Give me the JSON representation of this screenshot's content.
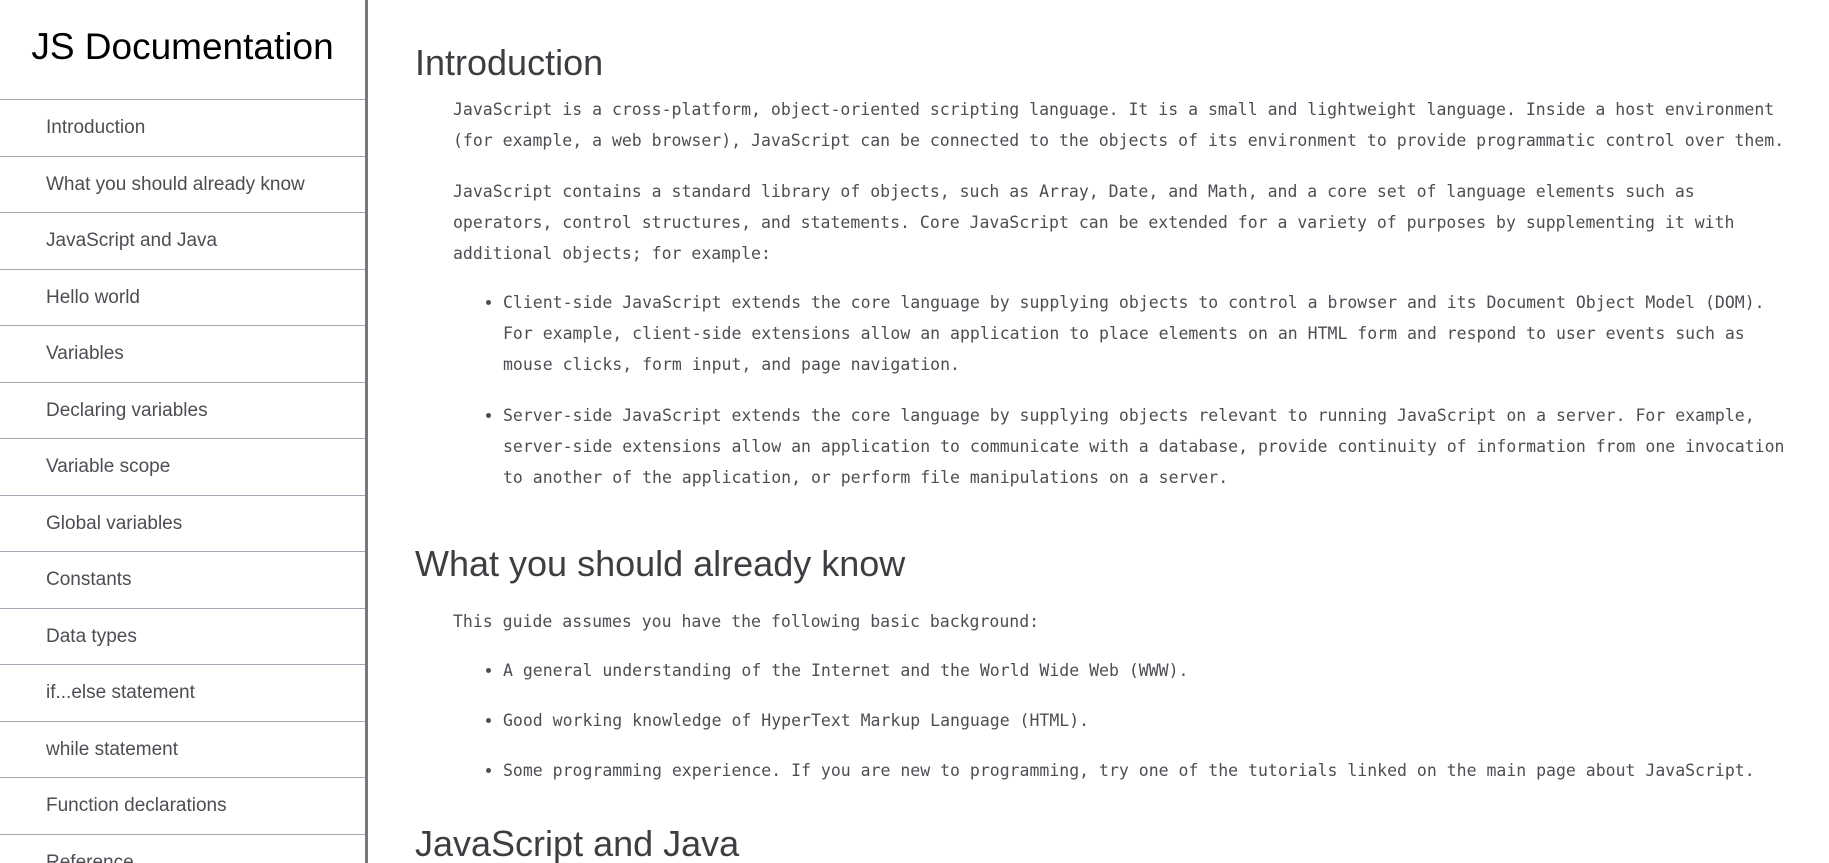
{
  "navbar": {
    "title": "JS Documentation",
    "items": [
      "Introduction",
      "What you should already know",
      "JavaScript and Java",
      "Hello world",
      "Variables",
      "Declaring variables",
      "Variable scope",
      "Global variables",
      "Constants",
      "Data types",
      "if...else statement",
      "while statement",
      "Function declarations",
      "Reference"
    ]
  },
  "main": {
    "intro": {
      "heading": "Introduction",
      "p1": "JavaScript is a cross-platform, object-oriented scripting language. It is a small and lightweight language. Inside a host environment (for example, a web browser), JavaScript can be connected to the objects of its environment to provide programmatic control over them.",
      "p2": "JavaScript contains a standard library of objects, such as Array, Date, and Math, and a core set of language elements such as operators, control structures, and statements. Core JavaScript can be extended for a variety of purposes by supplementing it with additional objects; for example:",
      "bullets": [
        "Client-side JavaScript extends the core language by supplying objects to control a browser and its Document Object Model (DOM). For example, client-side extensions allow an application to place elements on an HTML form and respond to user events such as mouse clicks, form input, and page navigation.",
        "Server-side JavaScript extends the core language by supplying objects relevant to running JavaScript on a server. For example, server-side extensions allow an application to communicate with a database, provide continuity of information from one invocation to another of the application, or perform file manipulations on a server."
      ]
    },
    "know": {
      "heading": "What you should already know",
      "p1": "This guide assumes you have the following basic background:",
      "bullets": [
        "A general understanding of the Internet and the World Wide Web (WWW).",
        "Good working knowledge of HyperText Markup Language (HTML).",
        "Some programming experience. If you are new to programming, try one of the tutorials linked on the main page about JavaScript."
      ]
    },
    "java": {
      "heading": "JavaScript and Java"
    }
  },
  "colors": {
    "nav_border": "#a0aab4",
    "sidebar_border": "#77777c",
    "text": "#4d4e53"
  }
}
